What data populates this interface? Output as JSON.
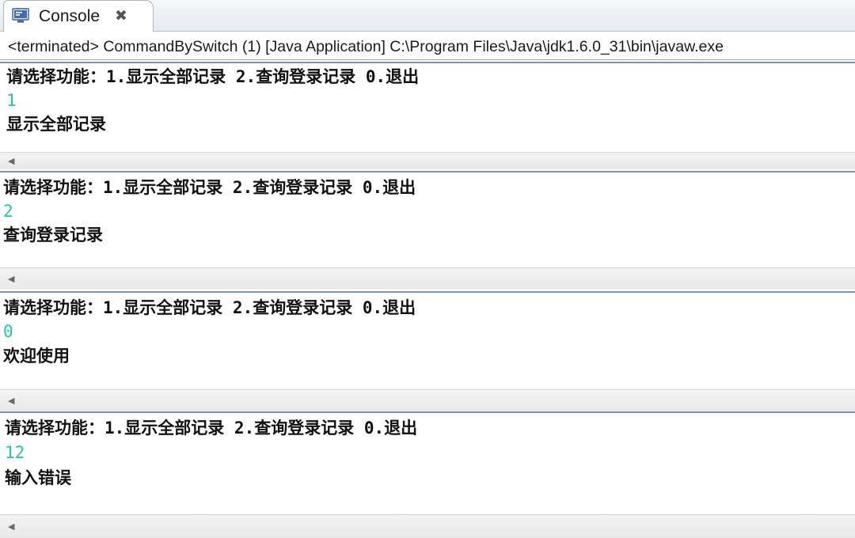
{
  "tab": {
    "title": "Console",
    "icon": "console-icon",
    "close_glyph": "✖"
  },
  "status": {
    "text": "<terminated> CommandBySwitch (1) [Java Application] C:\\Program Files\\Java\\jdk1.6.0_31\\bin\\javaw.exe"
  },
  "panels": [
    {
      "prompt": "请选择功能：1.显示全部记录 2.查询登录记录 0.退出",
      "input": "1",
      "output": "显示全部记录"
    },
    {
      "prompt": "请选择功能：1.显示全部记录 2.查询登录记录 0.退出",
      "input": "2",
      "output": "查询登录记录"
    },
    {
      "prompt": "请选择功能：1.显示全部记录 2.查询登录记录 0.退出",
      "input": "0",
      "output": "欢迎使用"
    },
    {
      "prompt": "请选择功能：1.显示全部记录 2.查询登录记录 0.退出",
      "input": "12",
      "output": "输入错误"
    }
  ],
  "colors": {
    "input_text": "#1cc8a6",
    "output_text": "#111111",
    "panel_border": "#7f94ad"
  }
}
